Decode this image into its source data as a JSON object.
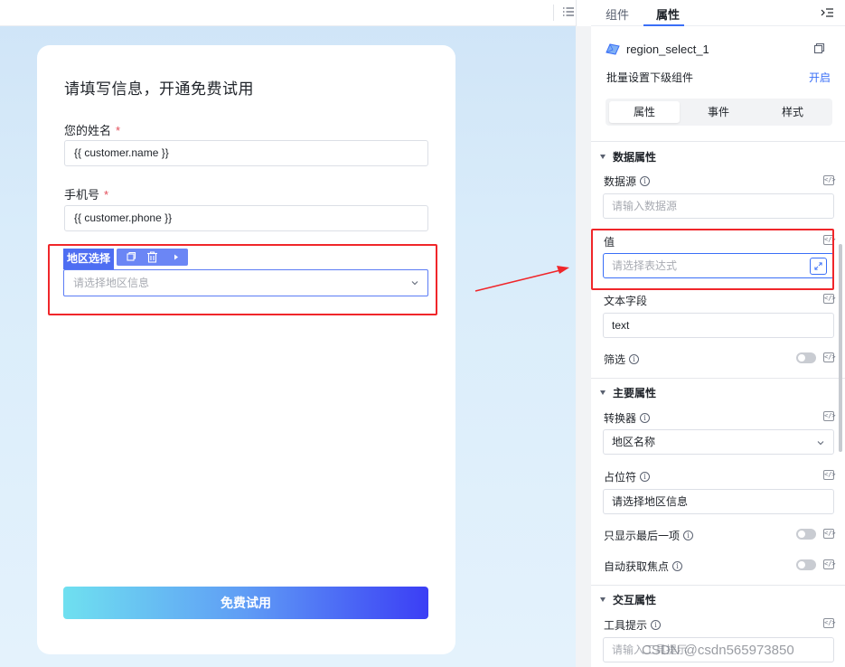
{
  "canvas": {
    "form": {
      "title": "请填写信息，开通免费试用",
      "name_label": "您的姓名",
      "name_value": "{{ customer.name }}",
      "phone_label": "手机号",
      "phone_value": "{{ customer.phone }}",
      "required_mark": "*",
      "region_tag": "地区选择",
      "region_placeholder": "请选择地区信息",
      "submit_label": "免费试用"
    }
  },
  "panel": {
    "tabs": [
      "组件",
      "属性"
    ],
    "component_name": "region_select_1",
    "batch_label": "批量设置下级组件",
    "batch_action": "开启",
    "segments": [
      "属性",
      "事件",
      "样式"
    ],
    "data_section": {
      "title": "数据属性",
      "datasource_label": "数据源",
      "datasource_placeholder": "请输入数据源",
      "value_label": "值",
      "value_placeholder": "请选择表达式",
      "textfield_label": "文本字段",
      "textfield_value": "text",
      "filter_label": "筛选"
    },
    "main_section": {
      "title": "主要属性",
      "converter_label": "转换器",
      "converter_value": "地区名称",
      "placeholder_label": "占位符",
      "placeholder_value": "请选择地区信息",
      "show_last_label": "只显示最后一项",
      "autofocus_label": "自动获取焦点"
    },
    "interaction_section": {
      "title": "交互属性",
      "tooltip_label": "工具提示",
      "tooltip_placeholder": "请输入工具提示"
    }
  },
  "watermark": "CSDN @csdn565973850",
  "colors": {
    "accent": "#3a6ff7",
    "highlight": "#f0262a",
    "selection": "#4e6ef2"
  }
}
